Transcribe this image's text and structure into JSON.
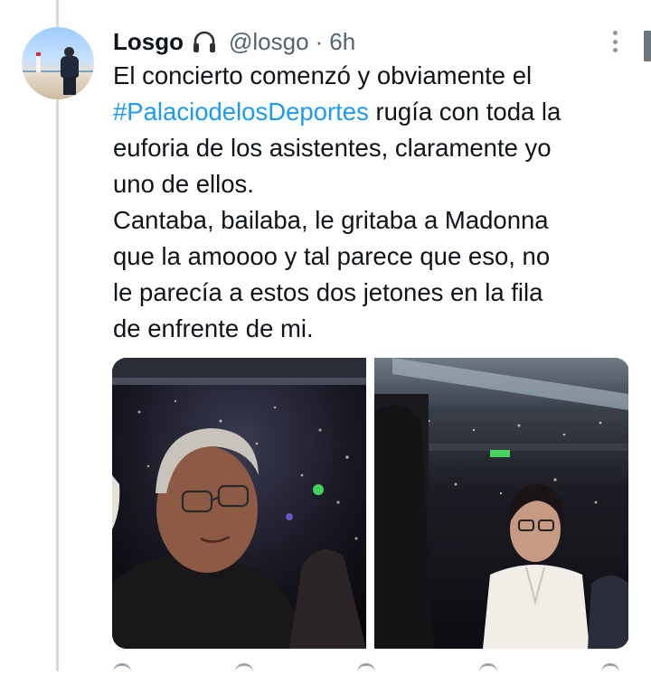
{
  "tweet": {
    "display_name": "Losgo",
    "display_name_emoji": "headphones-icon",
    "handle": "@losgo",
    "separator": "·",
    "timestamp": "6h",
    "text_lines": [
      "El concierto comenzó y obviamente el",
      "rugía con toda la",
      "euforia de los asistentes, claramente yo",
      "uno de ellos.",
      "Cantaba, bailaba, le gritaba a Madonna",
      "que la amoooo y tal parece que eso, no",
      "le parecía a estos dos jetones en la fila",
      "de enfrente de mi."
    ],
    "hashtag": "#PalaciodelosDeportes",
    "media_count": 2
  },
  "icons": {
    "more": "more-vertical-icon",
    "avatar": "avatar"
  },
  "colors": {
    "link": "#1d9bf0",
    "secondary_text": "#536471",
    "thread_line": "#cfd9de"
  }
}
